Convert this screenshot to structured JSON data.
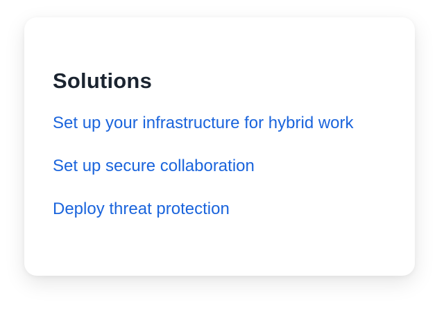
{
  "card": {
    "title": "Solutions",
    "links": [
      {
        "label": "Set up your infrastructure for hybrid work"
      },
      {
        "label": "Set up secure collaboration"
      },
      {
        "label": "Deploy threat protection"
      }
    ]
  },
  "colors": {
    "title": "#1b2430",
    "link": "#1a64dc",
    "background": "#ffffff"
  }
}
